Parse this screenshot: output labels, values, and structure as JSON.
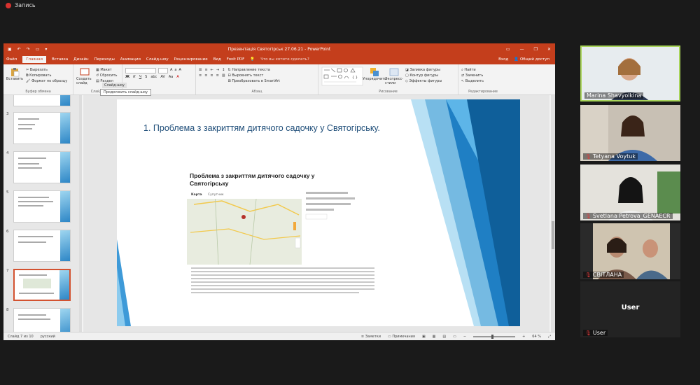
{
  "recording": {
    "label": "Запись"
  },
  "powerpoint": {
    "title": "Презентація Святогірськ 27.06.21 - PowerPoint",
    "tabs": [
      "Файл",
      "Главная",
      "Вставка",
      "Дизайн",
      "Переходы",
      "Анимация",
      "Слайд-шоу",
      "Рецензирование",
      "Вид",
      "Foxit PDF"
    ],
    "active_tab": "Главная",
    "search_placeholder": "Что вы хотите сделать?",
    "sign_in": "Вход",
    "share": "Общий доступ",
    "ribbon": {
      "clipboard": {
        "paste": "Вставить",
        "cut": "Вырезать",
        "copy": "Копировать",
        "format_painter": "Формат по образцу",
        "label": "Буфер обмена"
      },
      "slides": {
        "new_slide": "Создать слайд",
        "layout": "Макет",
        "reset": "Сбросить",
        "section": "Раздел",
        "label": "Слайды"
      },
      "paragraph": {
        "text_direction": "Направление текста",
        "align_text": "Выровнять текст",
        "smartart": "Преобразовать в SmartArt",
        "label": "Абзац"
      },
      "drawing": {
        "arrange": "Упорядочить",
        "quick_styles": "Экспресс-стили",
        "fill": "Заливка фигуры",
        "outline": "Контур фигуры",
        "effects": "Эффекты фигуры",
        "label": "Рисование"
      },
      "editing": {
        "find": "Найти",
        "replace": "Заменить",
        "select": "Выделить",
        "label": "Редактирование"
      }
    },
    "tooltip_top": "Слайд-шоу",
    "tooltip": "Продолжить слайд-шоу",
    "thumbnail_numbers": [
      "3",
      "4",
      "5",
      "6",
      "7",
      "8"
    ],
    "selected_slide": "7",
    "slide": {
      "heading_number": "1.",
      "heading_text": "Проблема з закриттям дитячого садочку у Святогірську.",
      "inner_title": "Проблема з закриттям дитячого садочку у Святогірську",
      "map_tab_map": "Карта",
      "map_tab_satellite": "Супутник"
    },
    "status": {
      "slide_info": "Слайд 7 из 10",
      "language": "русский",
      "notes": "Заметки",
      "comments": "Примечания",
      "zoom": "64 %"
    }
  },
  "participants": [
    {
      "name": "Marina Shavyolkina",
      "muted": false
    },
    {
      "name": "Tetyana Voytuk",
      "muted": true
    },
    {
      "name": "Svetlana Petrova_GENAECR",
      "muted": true
    },
    {
      "name": "СВІТЛАНА",
      "muted": true
    },
    {
      "name": "User",
      "muted": true,
      "center_label": "User"
    }
  ]
}
